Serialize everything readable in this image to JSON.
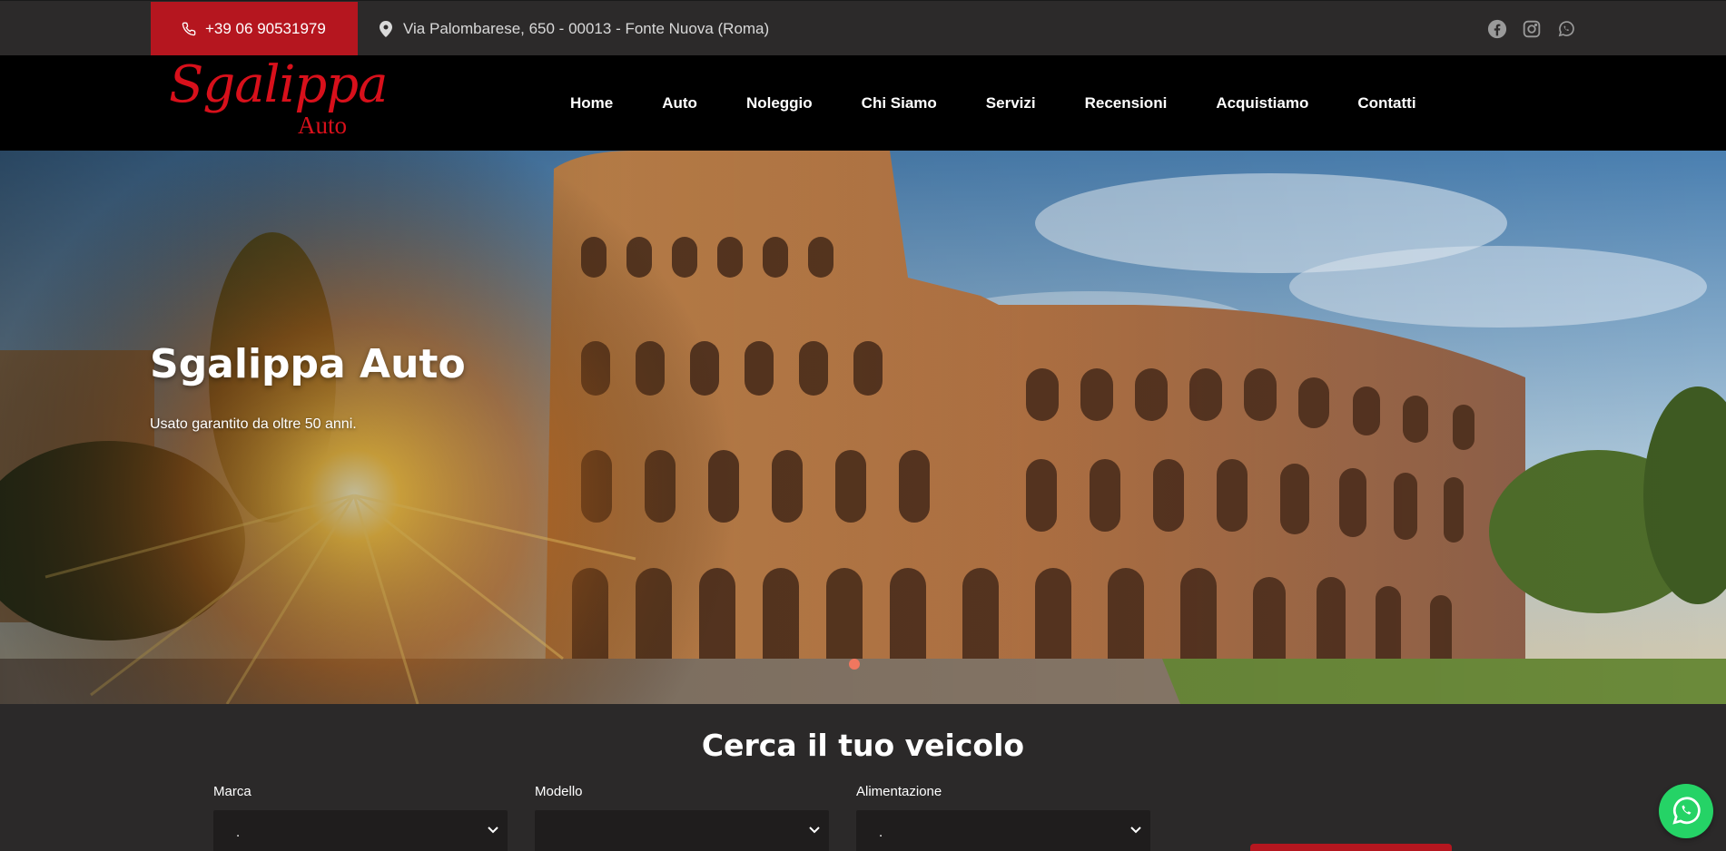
{
  "topbar": {
    "phone": "+39 06 90531979",
    "address": "Via Palombarese, 650 - 00013 - Fonte Nuova (Roma)",
    "socials": [
      "facebook-icon",
      "instagram-icon",
      "whatsapp-icon"
    ]
  },
  "logo": {
    "script": "Sgalippa",
    "sub": "Auto"
  },
  "nav": {
    "items": [
      "Home",
      "Auto",
      "Noleggio",
      "Chi Siamo",
      "Servizi",
      "Recensioni",
      "Acquistiamo",
      "Contatti"
    ]
  },
  "hero": {
    "title": "Sgalippa Auto",
    "subtitle": "Usato garantito da oltre 50 anni."
  },
  "search": {
    "title": "Cerca il tuo veicolo",
    "fields": [
      {
        "label": "Marca",
        "value": "."
      },
      {
        "label": "Modello",
        "value": ""
      },
      {
        "label": "Alimentazione",
        "value": "."
      }
    ]
  },
  "colors": {
    "brand_red": "#b5161f",
    "logo_red": "#d8101b",
    "whatsapp": "#25d366",
    "dark_bg": "#2b2929"
  }
}
